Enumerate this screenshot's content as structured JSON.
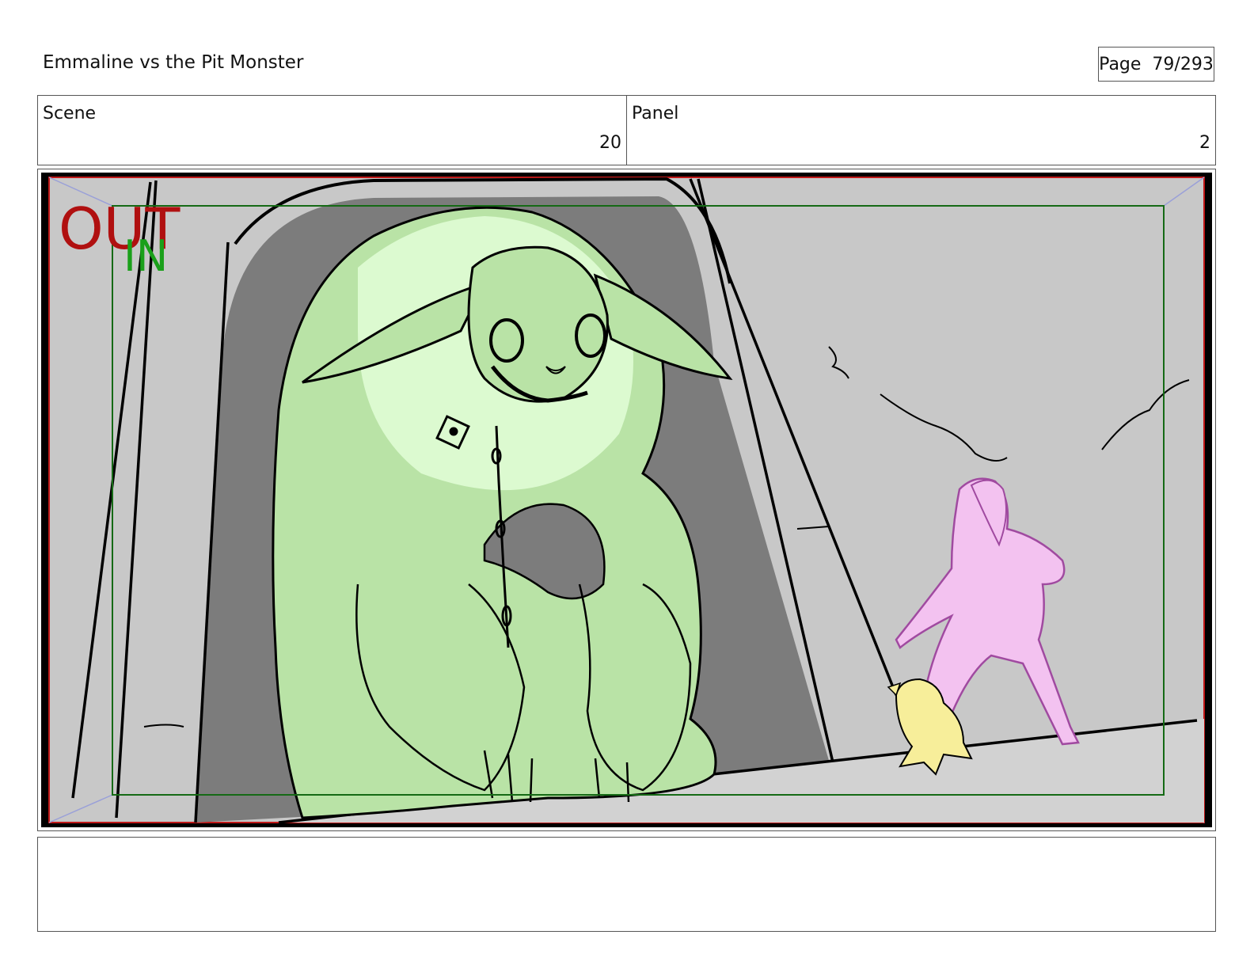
{
  "document": {
    "title": "Emmaline vs the Pit Monster",
    "page_label": "Page  79/293"
  },
  "header": {
    "scene_label": "Scene",
    "scene_value": "20",
    "panel_label": "Panel",
    "panel_value": "2"
  },
  "frame": {
    "out_label": "OUT",
    "in_label": "IN",
    "colors": {
      "out": "#b01010",
      "in": "#1aa01a",
      "monster": "#b9e3a6",
      "monster_highlight": "#dcfad0",
      "girl": "#f3c2f0",
      "cat": "#f7ee9a",
      "wall": "#c8c8c8",
      "shadow": "#7a7a7a"
    }
  },
  "notes": {
    "text": ""
  }
}
